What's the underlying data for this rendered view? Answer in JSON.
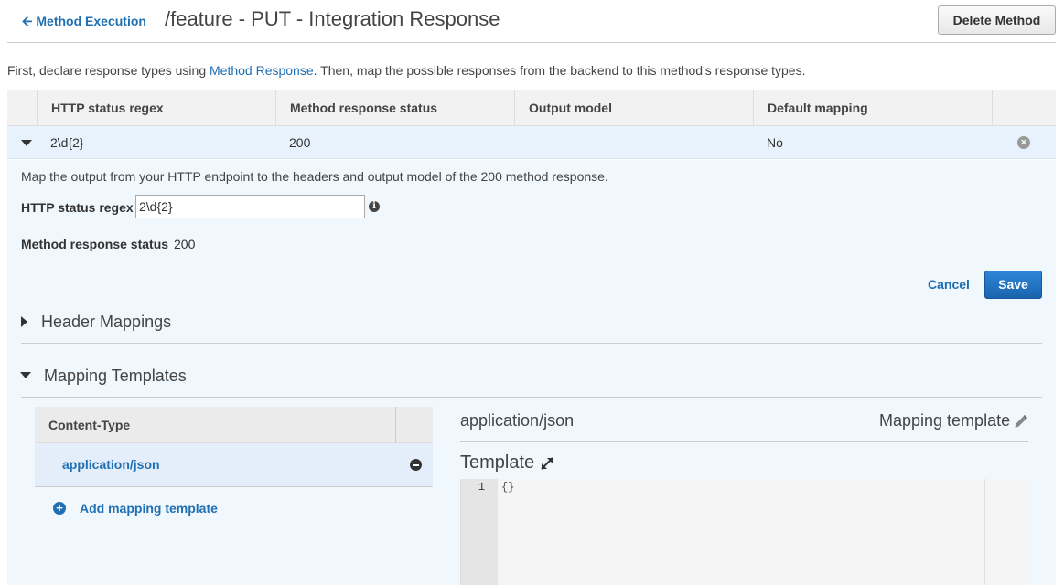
{
  "header": {
    "back_label": "Method Execution",
    "title": "/feature - PUT - Integration Response",
    "delete_label": "Delete Method"
  },
  "intro": {
    "prefix": "First, declare response types using ",
    "link": "Method Response",
    "suffix": ". Then, map the possible responses from the backend to this method's response types."
  },
  "table": {
    "headers": [
      "HTTP status regex",
      "Method response status",
      "Output model",
      "Default mapping"
    ],
    "row": {
      "regex": "2\\d{2}",
      "status": "200",
      "model": "",
      "default": "No"
    }
  },
  "detail": {
    "description": "Map the output from your HTTP endpoint to the headers and output model of the 200 method response.",
    "regex_label": "HTTP status regex",
    "regex_value": "2\\d{2}",
    "status_label": "Method response status",
    "status_value": "200",
    "cancel_label": "Cancel",
    "save_label": "Save"
  },
  "sections": {
    "header_mappings": "Header Mappings",
    "mapping_templates": "Mapping Templates"
  },
  "content_types": {
    "header": "Content-Type",
    "items": [
      "application/json"
    ],
    "add_label": "Add mapping template"
  },
  "template": {
    "content_type": "application/json",
    "mapping_label": "Mapping template",
    "label": "Template",
    "line_number": "1",
    "code": "{}"
  },
  "colors": {
    "link": "#1f6fb2",
    "selected_row": "#e8f2fc",
    "panel": "#f0f7fd",
    "save_button": "#1a63ad"
  }
}
